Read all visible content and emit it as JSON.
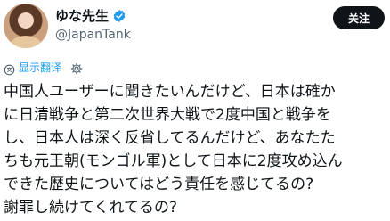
{
  "author": {
    "display_name": "ゆな先生",
    "handle": "@JapanTank",
    "verified_icon": "verified-badge-icon",
    "verified_color": "#1d9bf0"
  },
  "follow_button": {
    "label": "关注"
  },
  "translate": {
    "label": "显示翻译",
    "icon": "translate-icon",
    "settings_icon": "gear-icon"
  },
  "tweet": {
    "lines": [
      "中国人ユーザーに聞きたいんだけど、日本は確か",
      "に日清戦争と第二次世界大戦で2度中国と戦争を",
      "し、日本人は深く反省してるんだけど、あなたた",
      "ちも元王朝(モンゴル軍)として日本に2度攻め込ん",
      "できた歴史についてはどう責任を感じてるの?",
      "謝罪し続けてくれてるの?"
    ]
  },
  "colors": {
    "text": "#0f1419",
    "secondary": "#536471",
    "link": "#1d9bf0",
    "button_bg": "#0f1419"
  }
}
